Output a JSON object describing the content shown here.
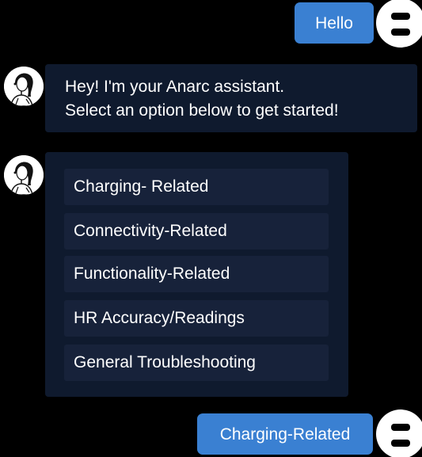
{
  "colors": {
    "background": "#000000",
    "user_bubble": "#3a80d2",
    "bot_bubble": "#0f1a2e",
    "option_button": "#17223a",
    "text": "#ffffff"
  },
  "conversation": {
    "user_message_1": "Hello",
    "bot_message": {
      "line1": "Hey! I'm your Anarc assistant.",
      "line2": "Select an option below to get started!"
    },
    "options": [
      "Charging- Related",
      "Connectivity-Related",
      "Functionality-Related",
      "HR Accuracy/Readings",
      "General Troubleshooting"
    ],
    "user_message_2": "Charging-Related"
  },
  "icons": {
    "user_avatar": "user-avatar-icon",
    "bot_avatar": "assistant-avatar-icon"
  }
}
